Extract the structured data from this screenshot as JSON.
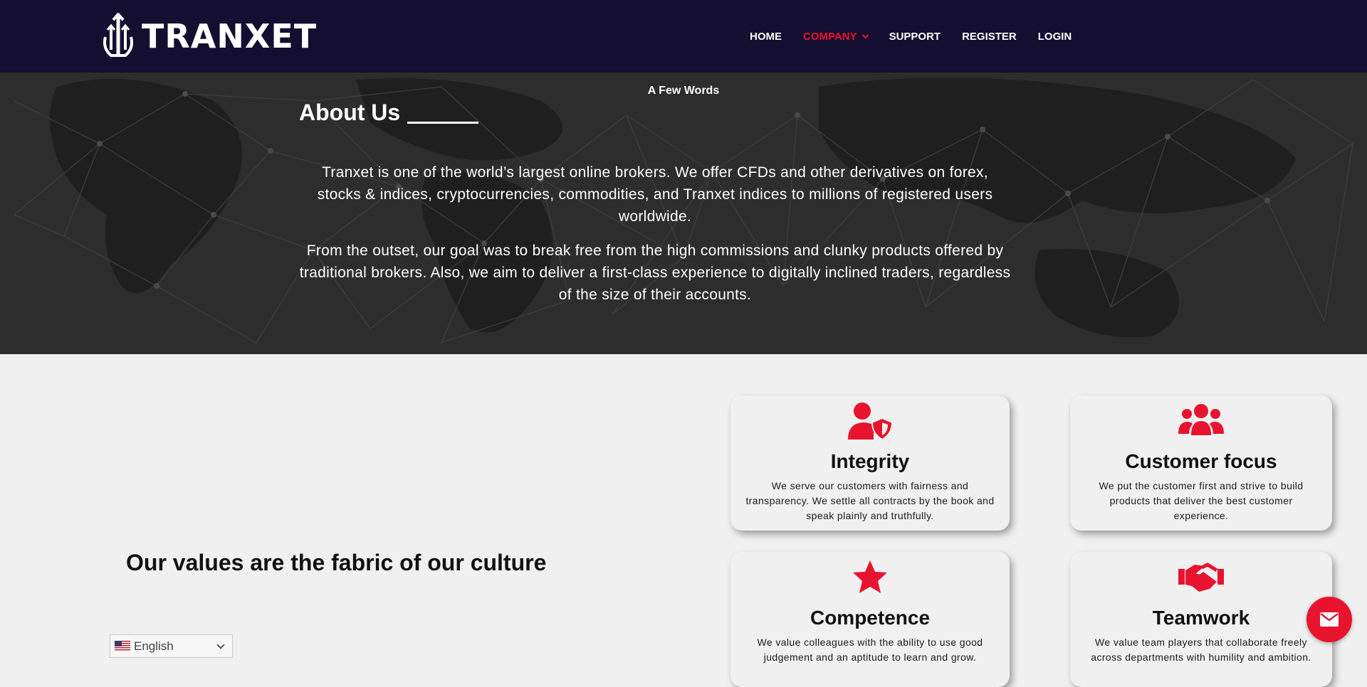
{
  "brand": {
    "name": "TRANXET"
  },
  "nav": {
    "items": [
      {
        "label": "HOME",
        "active": false
      },
      {
        "label": "COMPANY",
        "active": true,
        "has_dropdown": true
      },
      {
        "label": "SUPPORT",
        "active": false
      },
      {
        "label": "REGISTER",
        "active": false
      },
      {
        "label": "LOGIN",
        "active": false
      }
    ]
  },
  "hero": {
    "eyebrow": "A Few Words",
    "title": "About Us",
    "paragraphs": [
      "Tranxet is one of the world’s largest online brokers. We offer CFDs and other derivatives on forex, stocks & indices, cryptocurrencies, commodities, and Tranxet indices to millions of registered users worldwide.",
      "From the outset, our goal was to break free from the high commissions and clunky products offered by traditional brokers. Also, we aim to deliver a first-class experience to digitally inclined traders, regardless of the size of their accounts."
    ]
  },
  "values": {
    "title": "Our values are the fabric of our culture",
    "cards": [
      {
        "icon": "user-shield-icon",
        "title": "Integrity",
        "text": "We serve our customers with fairness and transparency. We settle all contracts by the book and speak plainly and truthfully."
      },
      {
        "icon": "users-icon",
        "title": "Customer focus",
        "text": "We put the customer first and strive to build products that deliver the best customer experience."
      },
      {
        "icon": "star-icon",
        "title": "Competence",
        "text": "We value colleagues with the ability to use good judgement and an aptitude to learn and grow."
      },
      {
        "icon": "handshake-icon",
        "title": "Teamwork",
        "text": "We value team players that collaborate freely across departments with humility and ambition."
      }
    ]
  },
  "language": {
    "selected": "English"
  },
  "colors": {
    "nav_bg": "#140e30",
    "accent": "#e8132e",
    "hero_bg": "#2d2d2d",
    "section_bg": "#f0f0f0"
  },
  "contact": {
    "icon": "mail-icon"
  }
}
